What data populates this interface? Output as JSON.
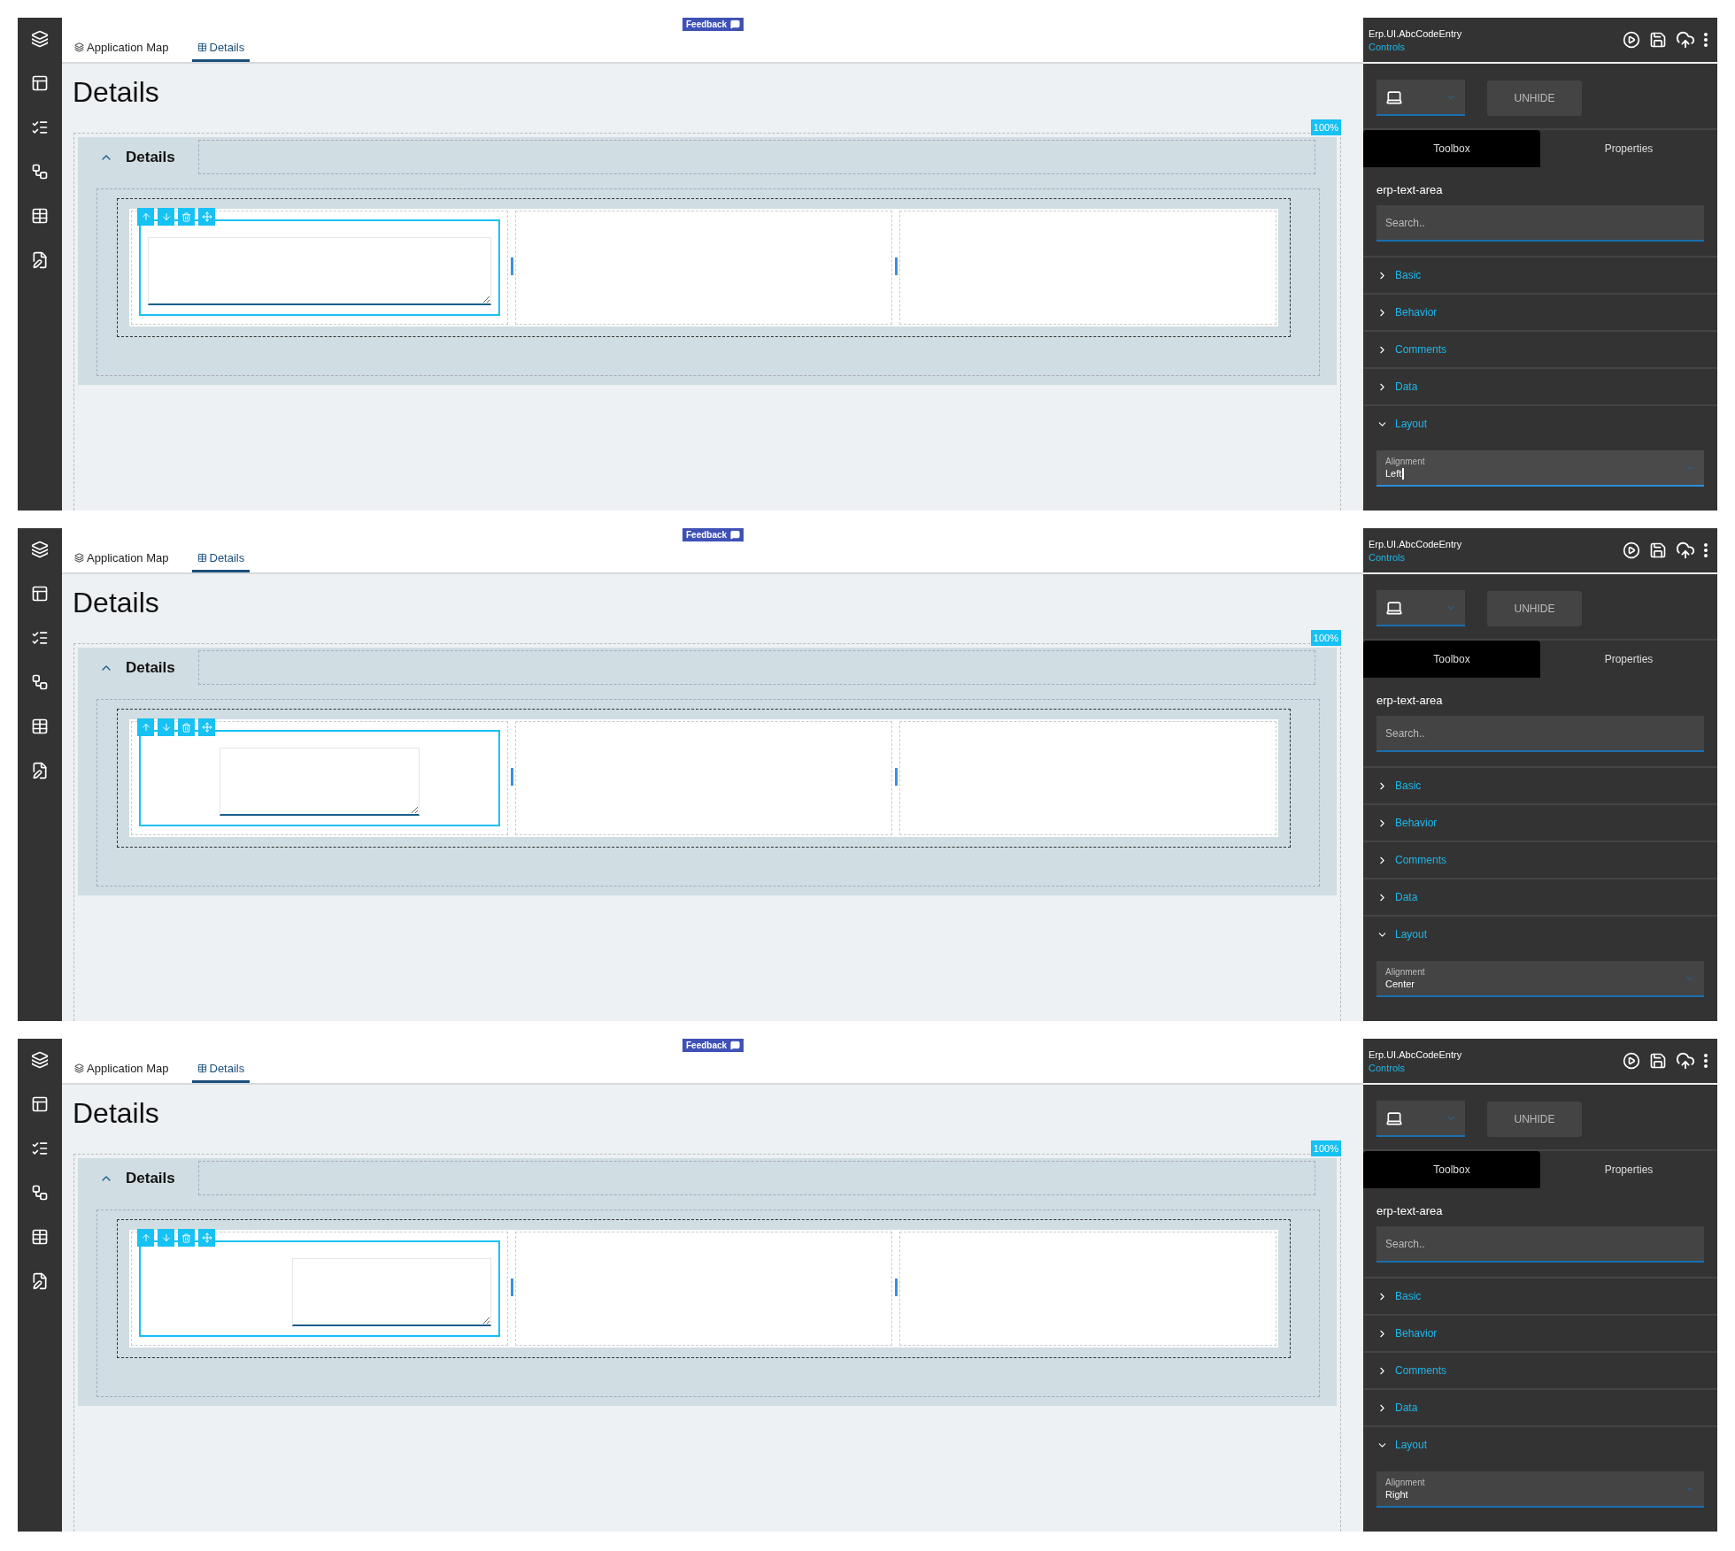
{
  "screens": [
    {
      "feedback": "Feedback",
      "tabs": [
        {
          "label": "Application Map",
          "selected": false
        },
        {
          "label": "Details",
          "selected": true
        }
      ],
      "title": "Details",
      "zoom": "100%",
      "section": {
        "title": "Details",
        "expanded": true
      },
      "text_area": {
        "centered": false,
        "right_aligned": false
      },
      "panel": {
        "title": "Erp.UI.AbcCodeEntry",
        "subtitle": "Controls",
        "unhide": "UNHIDE",
        "tabs": [
          {
            "label": "Toolbox",
            "selected": true
          },
          {
            "label": "Properties",
            "selected": false
          }
        ],
        "component": "erp-text-area",
        "search_placeholder": "Search..",
        "sections": [
          {
            "label": "Basic",
            "expanded": false
          },
          {
            "label": "Behavior",
            "expanded": false
          },
          {
            "label": "Comments",
            "expanded": false
          },
          {
            "label": "Data",
            "expanded": false
          },
          {
            "label": "Layout",
            "expanded": true
          }
        ],
        "alignment": {
          "label": "Alignment",
          "value": "Left",
          "focused": true
        }
      }
    },
    {
      "feedback": "Feedback",
      "tabs": [
        {
          "label": "Application Map",
          "selected": false
        },
        {
          "label": "Details",
          "selected": true
        }
      ],
      "title": "Details",
      "zoom": "100%",
      "section": {
        "title": "Details",
        "expanded": true
      },
      "text_area": {
        "centered": true,
        "right_aligned": false
      },
      "panel": {
        "title": "Erp.UI.AbcCodeEntry",
        "subtitle": "Controls",
        "unhide": "UNHIDE",
        "tabs": [
          {
            "label": "Toolbox",
            "selected": true
          },
          {
            "label": "Properties",
            "selected": false
          }
        ],
        "component": "erp-text-area",
        "search_placeholder": "Search..",
        "sections": [
          {
            "label": "Basic",
            "expanded": false
          },
          {
            "label": "Behavior",
            "expanded": false
          },
          {
            "label": "Comments",
            "expanded": false
          },
          {
            "label": "Data",
            "expanded": false
          },
          {
            "label": "Layout",
            "expanded": true
          }
        ],
        "alignment": {
          "label": "Alignment",
          "value": "Center",
          "focused": false
        }
      }
    },
    {
      "feedback": "Feedback",
      "tabs": [
        {
          "label": "Application Map",
          "selected": false
        },
        {
          "label": "Details",
          "selected": true
        }
      ],
      "title": "Details",
      "zoom": "100%",
      "section": {
        "title": "Details",
        "expanded": true
      },
      "text_area": {
        "centered": false,
        "right_aligned": true
      },
      "panel": {
        "title": "Erp.UI.AbcCodeEntry",
        "subtitle": "Controls",
        "unhide": "UNHIDE",
        "tabs": [
          {
            "label": "Toolbox",
            "selected": true
          },
          {
            "label": "Properties",
            "selected": false
          }
        ],
        "component": "erp-text-area",
        "search_placeholder": "Search..",
        "sections": [
          {
            "label": "Basic",
            "expanded": false
          },
          {
            "label": "Behavior",
            "expanded": false
          },
          {
            "label": "Comments",
            "expanded": false
          },
          {
            "label": "Data",
            "expanded": false
          },
          {
            "label": "Layout",
            "expanded": true
          }
        ],
        "alignment": {
          "label": "Alignment",
          "value": "Right",
          "focused": false
        }
      }
    }
  ]
}
